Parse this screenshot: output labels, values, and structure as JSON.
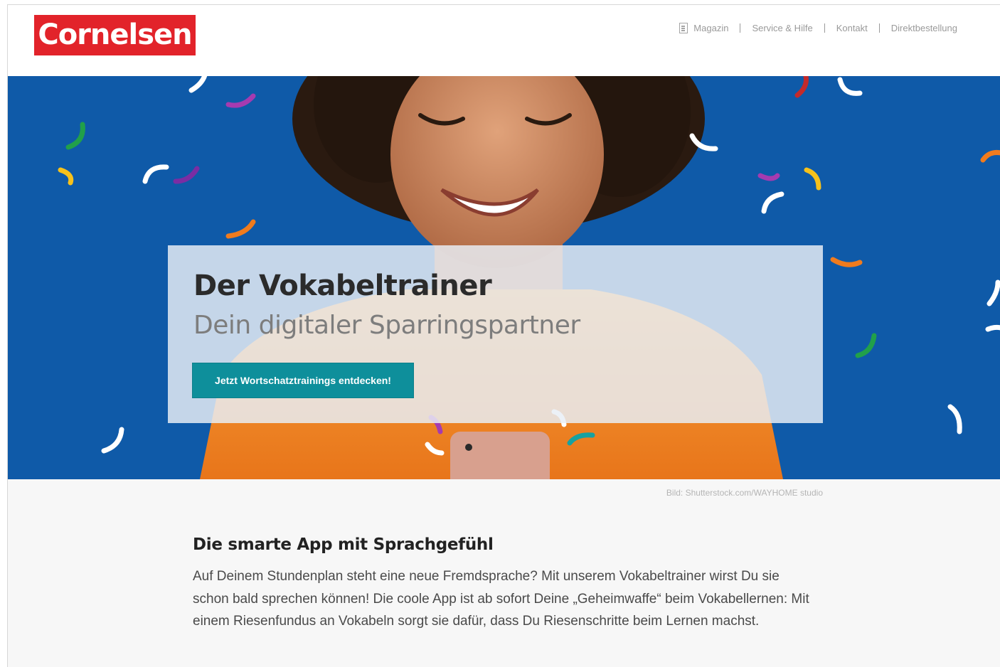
{
  "header": {
    "logo_text": "Cornelsen",
    "nav": [
      {
        "label": "Magazin",
        "icon": "magazine-icon"
      },
      {
        "label": "Service & Hilfe"
      },
      {
        "label": "Kontakt"
      },
      {
        "label": "Direktbestellung"
      }
    ]
  },
  "hero": {
    "title": "Der Vokabeltrainer",
    "subtitle": "Dein digitaler Sparringspartner",
    "cta_label": "Jetzt Wortschatztrainings entdecken!"
  },
  "image_credit": "Bild: Shutterstock.com/WAYHOME studio",
  "section": {
    "title": "Die smarte App mit Sprachgefühl",
    "text": "Auf Deinem Stundenplan steht eine neue Fremdsprache? Mit unserem Vokabeltrainer wirst Du sie schon bald sprechen können! Die coole App ist ab sofort Deine „Geheimwaffe“ beim Vokabellernen: Mit einem Riesenfundus an Vokabeln sorgt sie dafür, dass Du Riesenschritte beim Lernen machst."
  },
  "colors": {
    "brand_red": "#e2232a",
    "hero_blue": "#0f5aa8",
    "cta_teal": "#0e8f9b"
  }
}
